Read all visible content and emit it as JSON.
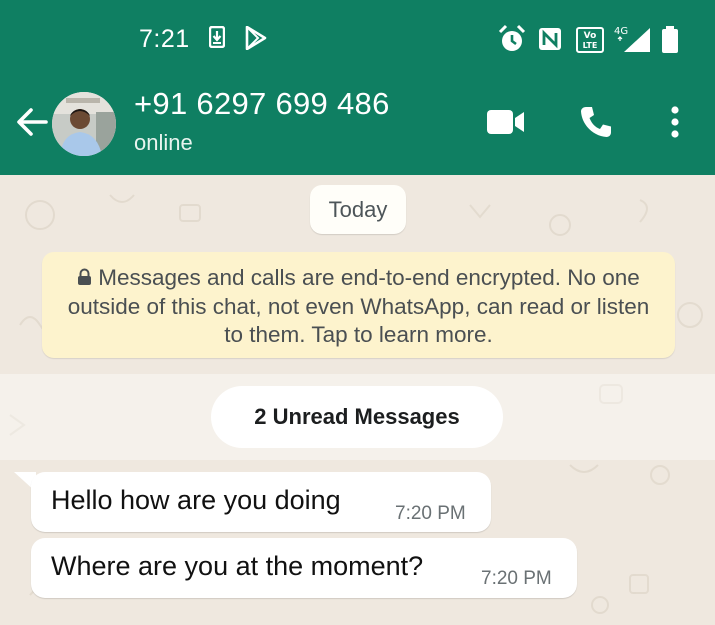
{
  "status_bar": {
    "time": "7:21",
    "volte_label_top": "Vo",
    "volte_label_bottom": "LTE",
    "network": "4G"
  },
  "header": {
    "contact_name": "+91 6297 699 486",
    "contact_status": "online",
    "icons": [
      "back-arrow-icon",
      "avatar",
      "video-call-icon",
      "voice-call-icon",
      "more-options-icon"
    ]
  },
  "chat": {
    "date_label": "Today",
    "encryption_notice": "Messages and calls are end-to-end encrypted. No one outside of this chat, not even WhatsApp, can read or listen to them. Tap to learn more.",
    "unread_label": "2 Unread Messages",
    "messages": [
      {
        "text": "Hello how are you doing",
        "time": "7:20 PM"
      },
      {
        "text": "Where are you at the moment?",
        "time": "7:20 PM"
      }
    ]
  },
  "colors": {
    "header": "#0f7f62",
    "chat_background": "#efe8df",
    "encryption_notice_bg": "#fdf3cd",
    "bubble": "#ffffff"
  }
}
